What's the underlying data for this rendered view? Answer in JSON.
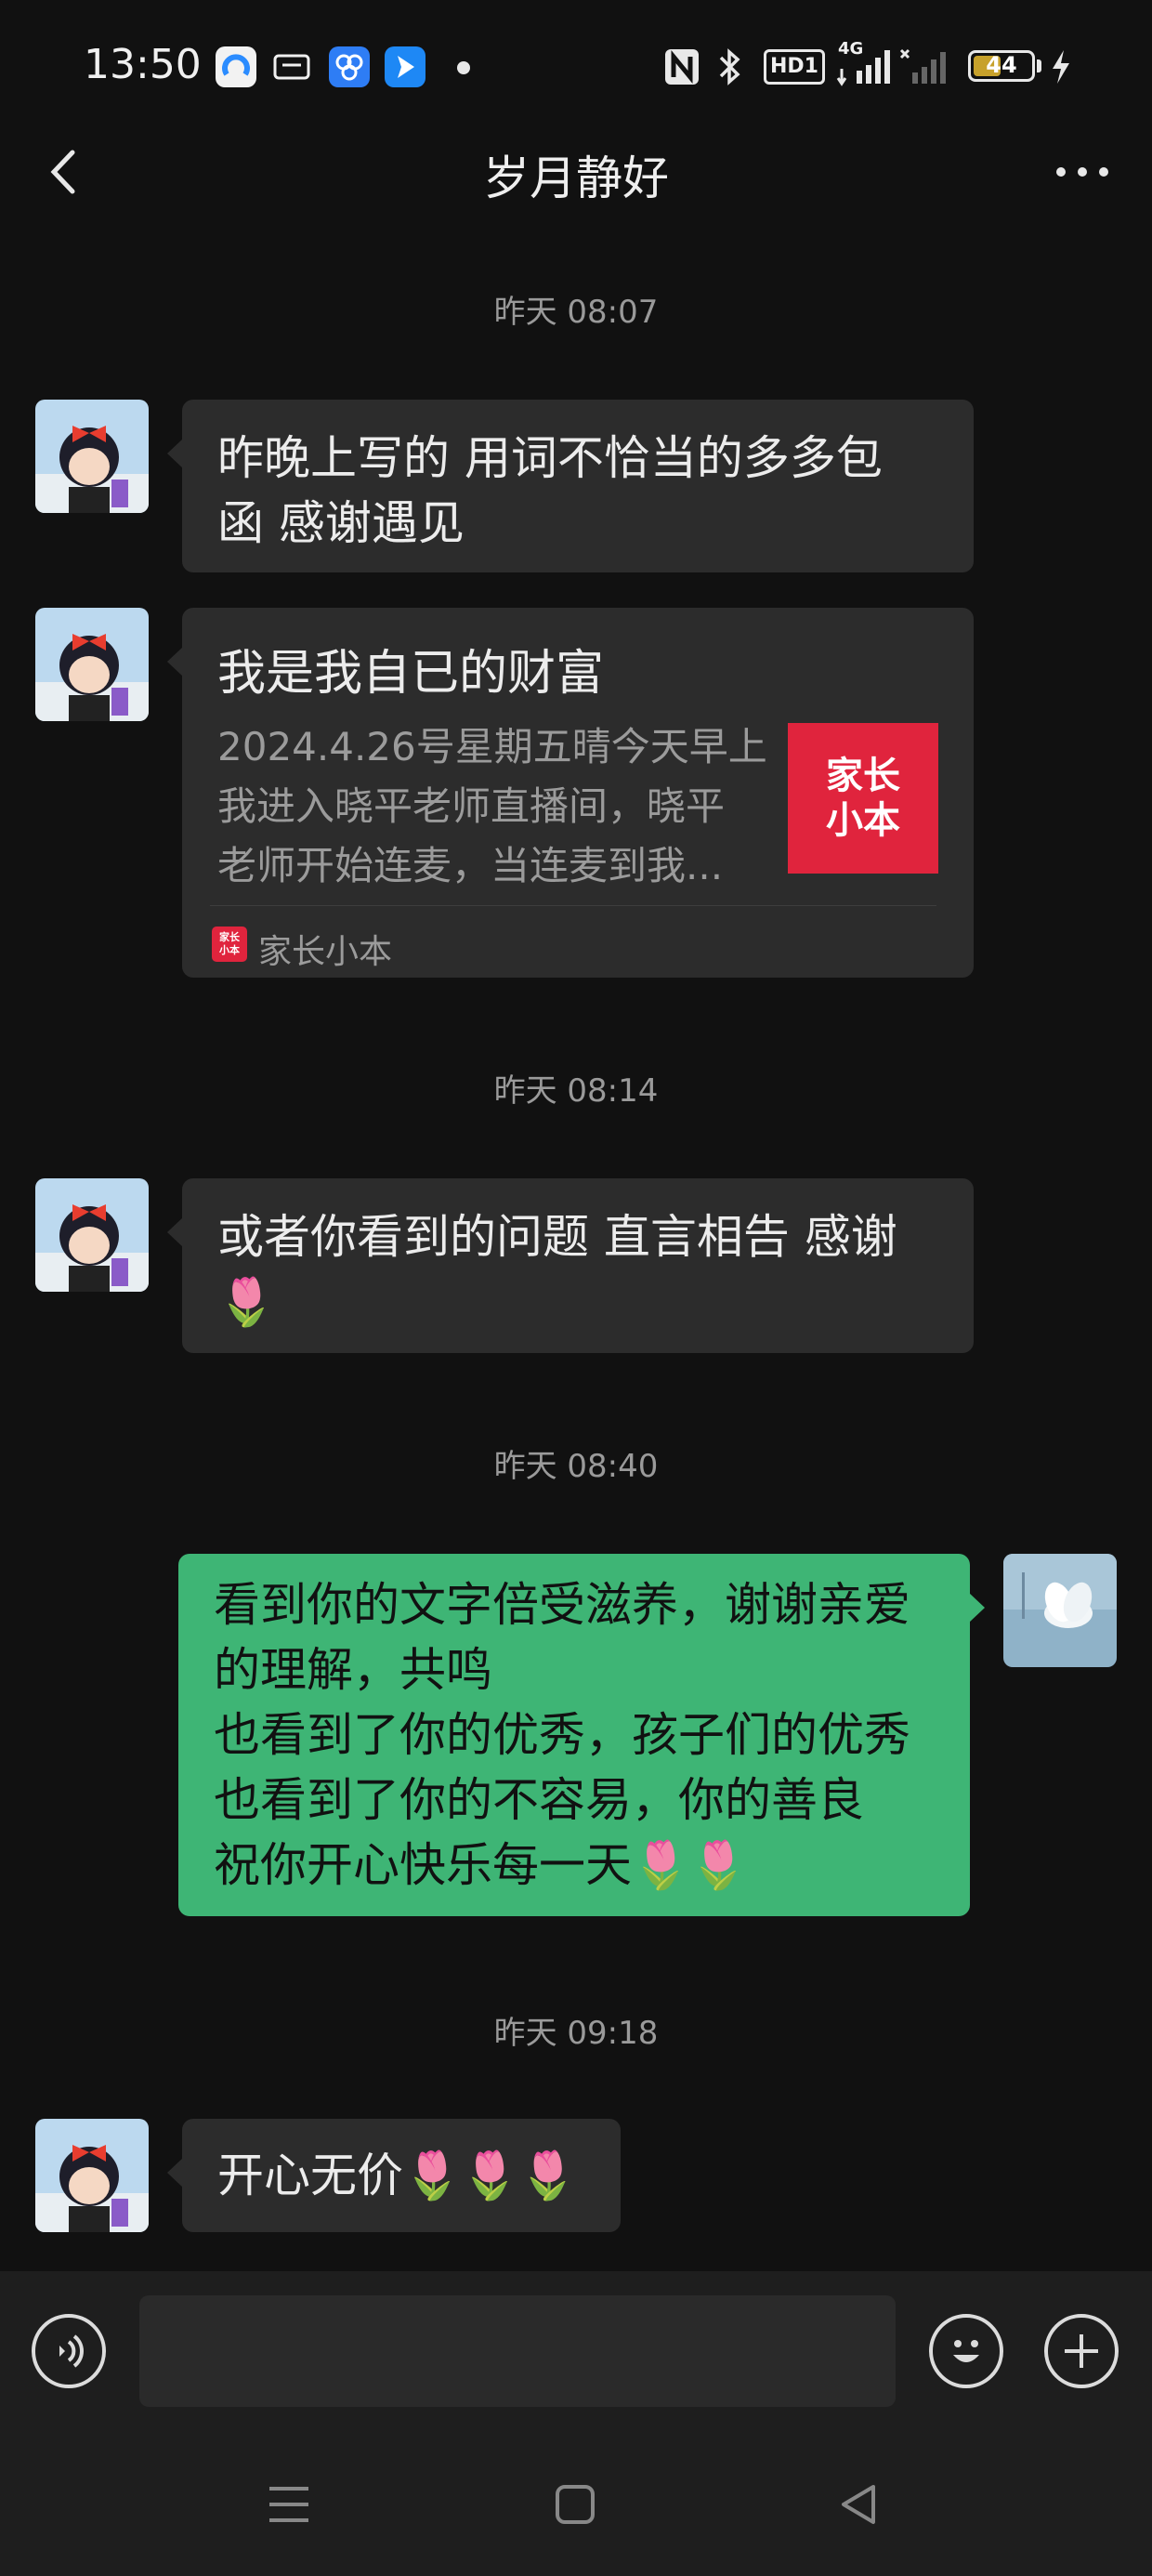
{
  "status_bar": {
    "time": "13:50",
    "app_icons": [
      "browser-app-icon",
      "chat-app-icon",
      "network-app-icon",
      "location-app-icon"
    ],
    "network_text": "4G",
    "hd_text": "HD1",
    "battery_level": "44",
    "battery_fraction": 0.44
  },
  "header": {
    "title": "岁月静好"
  },
  "messages": [
    {
      "type": "timestamp",
      "text": "昨天 08:07"
    },
    {
      "type": "text",
      "from": "them",
      "lines": [
        "昨晚上写的 用词不恰当的多多包",
        "函 感谢遇见"
      ]
    },
    {
      "type": "card",
      "from": "them",
      "title": "我是我自已的财富",
      "description_lines": [
        "2024.4.26号星期五晴今天早上",
        "我进入晓平老师直播间，晓平",
        "老师开始连麦，当连麦到我..."
      ],
      "thumb_lines": [
        "家长",
        "小本"
      ],
      "source": "家长小本",
      "source_icon_lines": [
        "家长",
        "小本"
      ]
    },
    {
      "type": "timestamp",
      "text": "昨天 08:14"
    },
    {
      "type": "text",
      "from": "them",
      "lines": [
        "或者你看到的问题 直言相告 感谢",
        "🌷"
      ]
    },
    {
      "type": "timestamp",
      "text": "昨天 08:40"
    },
    {
      "type": "text",
      "from": "me",
      "lines": [
        "看到你的文字倍受滋养，谢谢亲爱",
        "的理解，共鸣",
        "也看到了你的优秀，孩子们的优秀",
        "也看到了你的不容易，你的善良",
        "祝你开心快乐每一天🌷🌷"
      ]
    },
    {
      "type": "timestamp",
      "text": "昨天 09:18"
    },
    {
      "type": "text",
      "from": "them",
      "lines": [
        "开心无价🌷🌷🌷"
      ]
    }
  ],
  "input_bar": {
    "placeholder": "",
    "voice_icon": "voice-icon",
    "emoji_icon": "emoji-icon",
    "plus_icon": "plus-icon"
  },
  "nav_bar": {
    "icons": [
      "menu-icon",
      "home-icon",
      "back-triangle-icon"
    ]
  },
  "colors": {
    "background": "#111111",
    "bubble_them": "#2c2c2c",
    "bubble_me": "#3eb575",
    "brand_red": "#e0243d"
  }
}
